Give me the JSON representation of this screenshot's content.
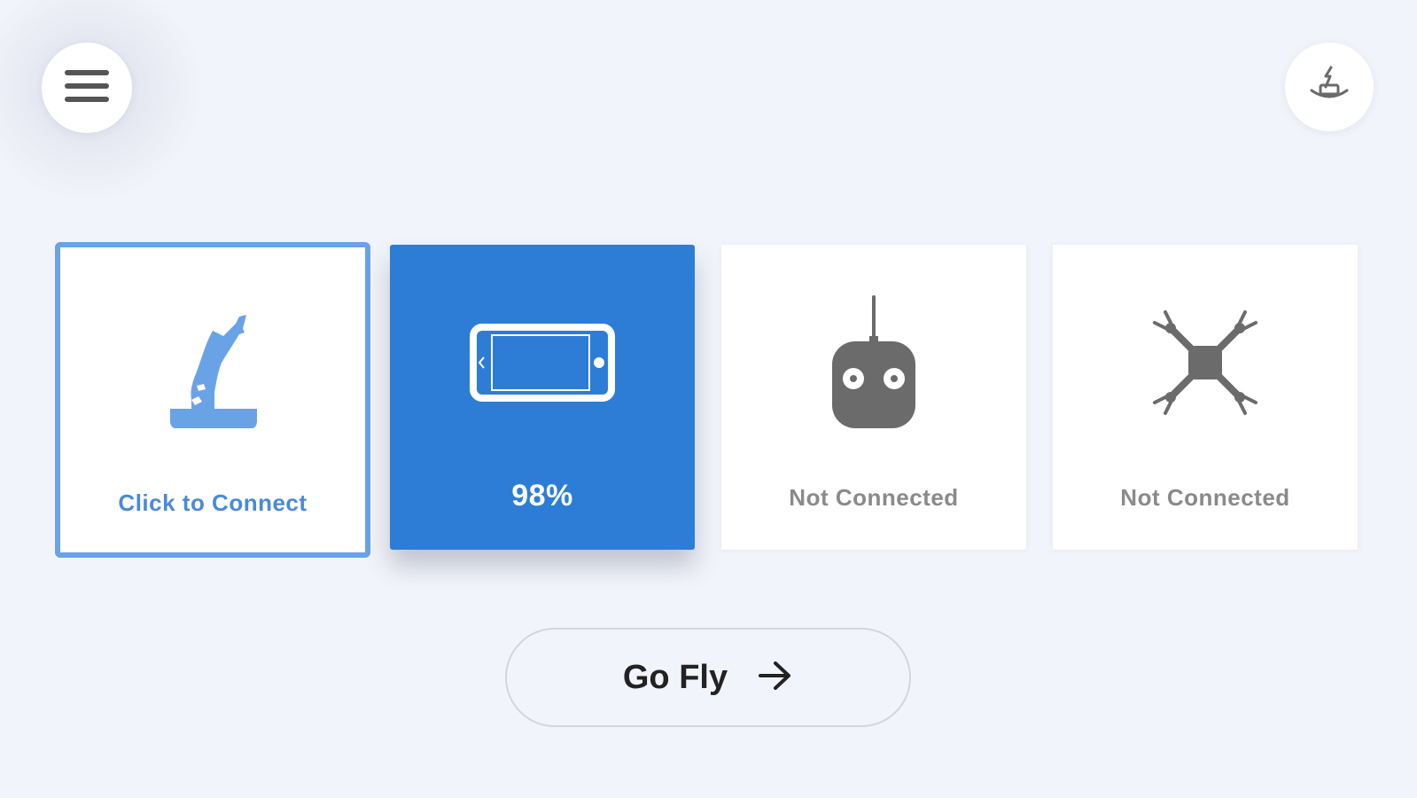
{
  "header": {
    "menu_icon": "hamburger-menu-icon",
    "return_icon": "return-home-icon"
  },
  "devices": [
    {
      "icon": "remote-controller-stand-icon",
      "label": "Click to Connect",
      "state": "selected"
    },
    {
      "icon": "phone-landscape-icon",
      "label": "98%",
      "state": "active"
    },
    {
      "icon": "remote-controller-icon",
      "label": "Not Connected",
      "state": "disconnected"
    },
    {
      "icon": "drone-icon",
      "label": "Not Connected",
      "state": "disconnected"
    }
  ],
  "actions": {
    "go_fly_label": "Go Fly",
    "go_fly_icon": "arrow-right-icon"
  },
  "colors": {
    "background": "#f2f4fb",
    "accent": "#2d7dd6",
    "accent_light": "#6aa2e6",
    "muted": "#8a8a8a",
    "icon_gray": "#6b6b6b"
  }
}
